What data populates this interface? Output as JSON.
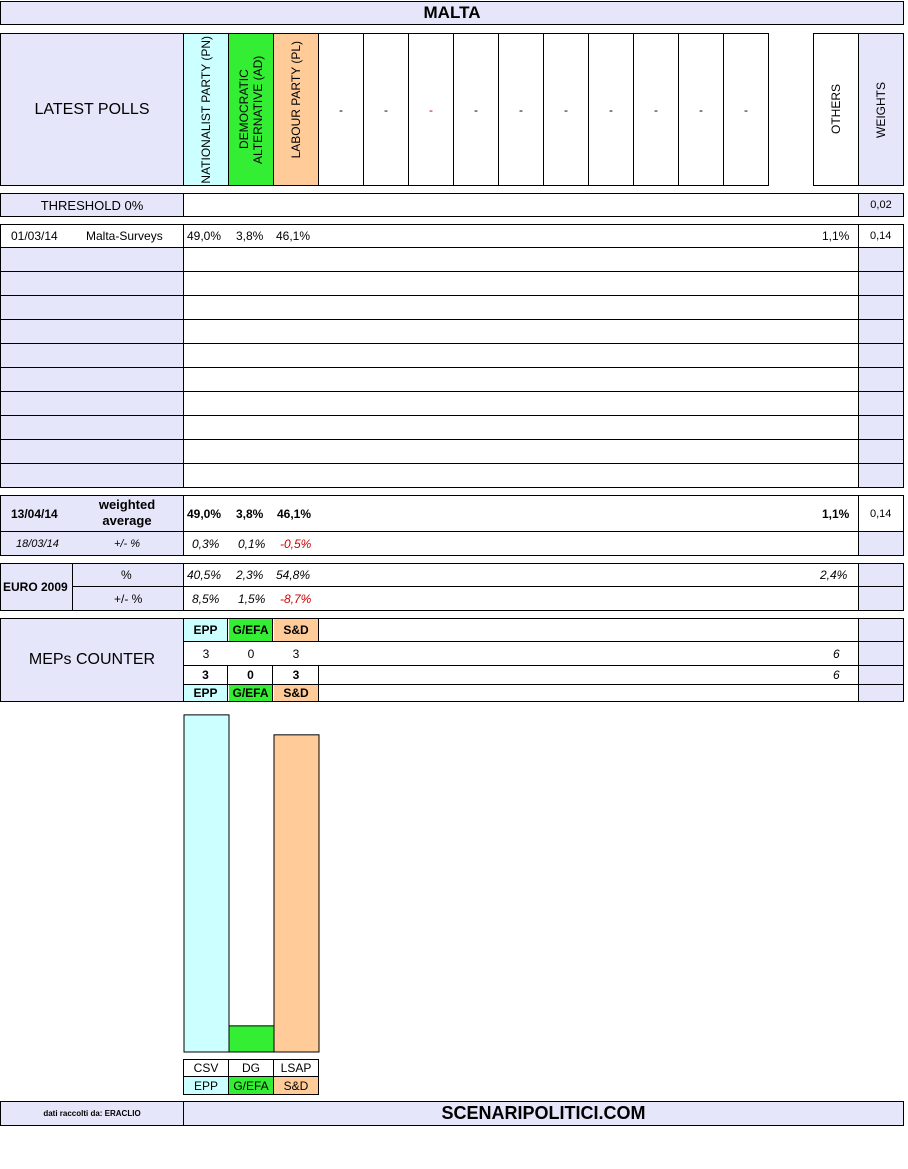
{
  "title": "MALTA",
  "header": {
    "latest_polls": "LATEST POLLS",
    "parties": [
      "NATIONALIST PARTY (PN)",
      "DEMOCRATIC ALTERNATIVE (AD)",
      "LABOUR PARTY (PL)"
    ],
    "empty_cols": [
      "-",
      "-",
      "-",
      "-",
      "-",
      "-",
      "-",
      "-",
      "-",
      "-"
    ],
    "others": "OTHERS",
    "weights": "WEIGHTS"
  },
  "threshold": {
    "label": "THRESHOLD 0%",
    "weight": "0,02"
  },
  "poll": {
    "date": "01/03/14",
    "pollster": "Malta-Surveys",
    "values": [
      "49,0%",
      "3,8%",
      "46,1%"
    ],
    "others": "1,1%",
    "weight": "0,14"
  },
  "weighted": {
    "date": "13/04/14",
    "label": "weighted average",
    "values": [
      "49,0%",
      "3,8%",
      "46,1%"
    ],
    "others": "1,1%",
    "weight": "0,14",
    "prev_date": "18/03/14",
    "diff_label": "+/- %",
    "diff": [
      "0,3%",
      "0,1%",
      "-0,5%"
    ]
  },
  "euro2009": {
    "label": "EURO 2009",
    "pct_label": "%",
    "values": [
      "40,5%",
      "2,3%",
      "54,8%"
    ],
    "others": "2,4%",
    "diff_label": "+/- %",
    "diff": [
      "8,5%",
      "1,5%",
      "-8,7%"
    ]
  },
  "meps": {
    "label": "MEPs COUNTER",
    "groups": [
      "EPP",
      "G/EFA",
      "S&D"
    ],
    "row1": [
      "3",
      "0",
      "3"
    ],
    "row1_total": "6",
    "row2": [
      "3",
      "0",
      "3"
    ],
    "row2_total": "6"
  },
  "chart_data": {
    "type": "bar",
    "categories": [
      "CSV",
      "DG",
      "LSAP"
    ],
    "groups": [
      "EPP",
      "G/EFA",
      "S&D"
    ],
    "values": [
      49.0,
      3.8,
      46.1
    ],
    "colors": [
      "#ccffff",
      "#33ee33",
      "#ffcc99"
    ],
    "title": "",
    "xlabel": "",
    "ylabel": "",
    "ylim": [
      0,
      50
    ]
  },
  "footer": {
    "credit": "dati raccolti da: ERACLIO",
    "site": "SCENARIPOLITICI.COM"
  }
}
